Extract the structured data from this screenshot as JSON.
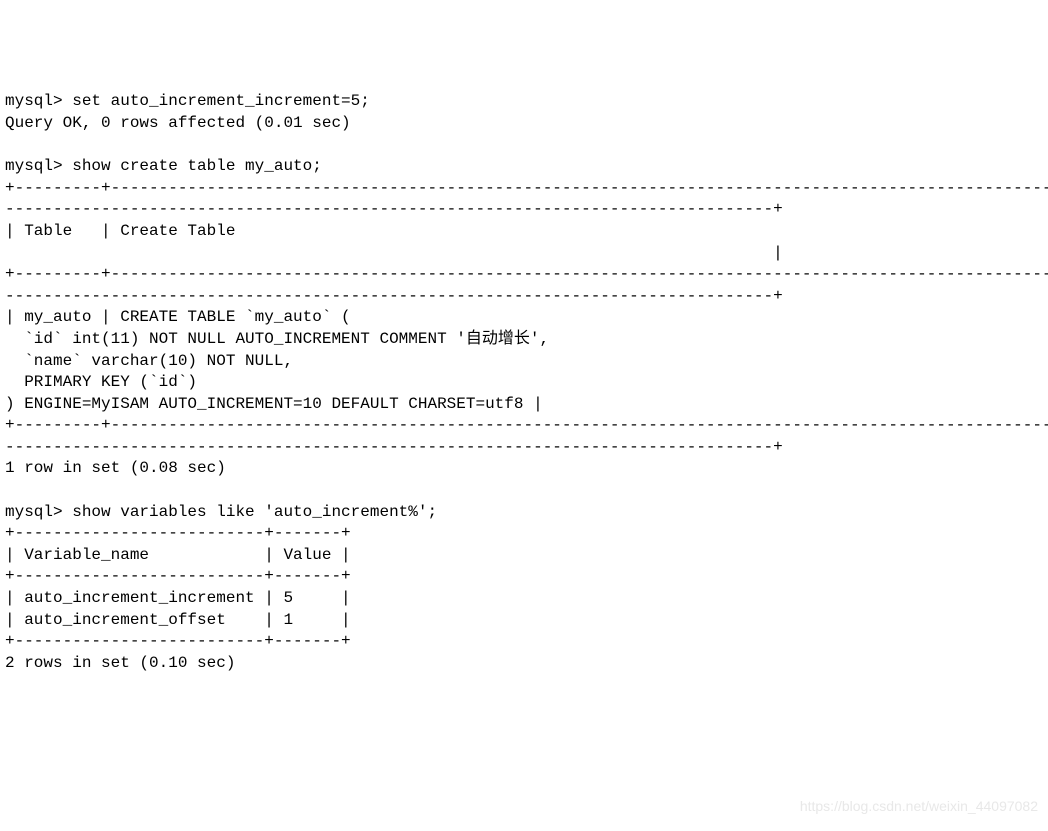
{
  "lines": [
    "mysql> set auto_increment_increment=5;",
    "Query OK, 0 rows affected (0.01 sec)",
    "",
    "mysql> show create table my_auto;",
    "+---------+---------------------------------------------------------------------------------------------------",
    "--------------------------------------------------------------------------------+",
    "| Table   | Create Table",
    "                                                                                |",
    "+---------+---------------------------------------------------------------------------------------------------",
    "--------------------------------------------------------------------------------+",
    "| my_auto | CREATE TABLE `my_auto` (",
    "  `id` int(11) NOT NULL AUTO_INCREMENT COMMENT '自动增长',",
    "  `name` varchar(10) NOT NULL,",
    "  PRIMARY KEY (`id`)",
    ") ENGINE=MyISAM AUTO_INCREMENT=10 DEFAULT CHARSET=utf8 |",
    "+---------+---------------------------------------------------------------------------------------------------",
    "--------------------------------------------------------------------------------+",
    "1 row in set (0.08 sec)",
    "",
    "mysql> show variables like 'auto_increment%';",
    "+--------------------------+-------+",
    "| Variable_name            | Value |",
    "+--------------------------+-------+",
    "| auto_increment_increment | 5     |",
    "| auto_increment_offset    | 1     |",
    "+--------------------------+-------+",
    "2 rows in set (0.10 sec)"
  ],
  "watermark": "https://blog.csdn.net/weixin_44097082"
}
